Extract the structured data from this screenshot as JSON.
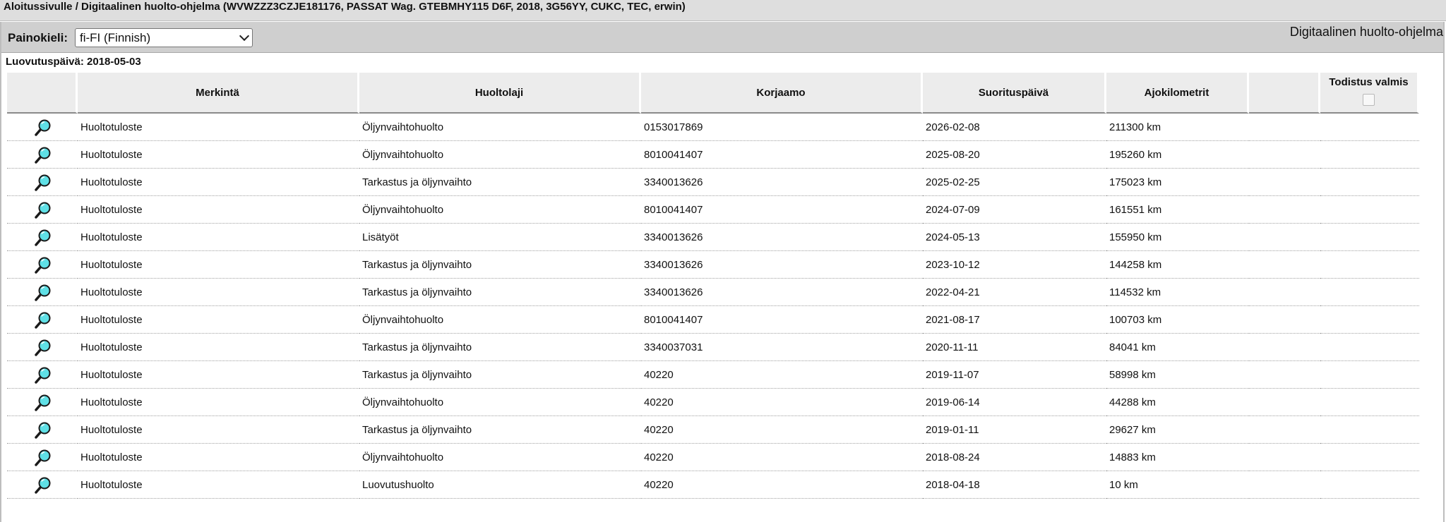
{
  "breadcrumb": "Aloitussivulle / Digitaalinen huolto-ohjelma (WVWZZZ3CZJE181176, PASSAT Wag. GTEBMHY115 D6F, 2018, 3G56YY, CUKC, TEC, erwin)",
  "toolbar": {
    "language_label": "Painokieli:",
    "language_value": "fi-FI (Finnish)",
    "title": "Digitaalinen huolto-ohjelma"
  },
  "handover_date": "Luovutuspäivä: 2018-05-03",
  "table": {
    "headers": {
      "marking": "Merkintä",
      "service_type": "Huoltolaji",
      "workshop": "Korjaamo",
      "date": "Suorituspäivä",
      "mileage": "Ajokilometrit",
      "certificate": "Todistus valmis"
    },
    "rows": [
      {
        "marking": "Huoltotuloste",
        "service_type": "Öljynvaihtohuolto",
        "workshop": "0153017869",
        "date": "2026-02-08",
        "mileage": "211300 km"
      },
      {
        "marking": "Huoltotuloste",
        "service_type": "Öljynvaihtohuolto",
        "workshop": "8010041407",
        "date": "2025-08-20",
        "mileage": "195260 km"
      },
      {
        "marking": "Huoltotuloste",
        "service_type": "Tarkastus ja öljynvaihto",
        "workshop": "3340013626",
        "date": "2025-02-25",
        "mileage": "175023 km"
      },
      {
        "marking": "Huoltotuloste",
        "service_type": "Öljynvaihtohuolto",
        "workshop": "8010041407",
        "date": "2024-07-09",
        "mileage": "161551 km"
      },
      {
        "marking": "Huoltotuloste",
        "service_type": "Lisätyöt",
        "workshop": "3340013626",
        "date": "2024-05-13",
        "mileage": "155950 km"
      },
      {
        "marking": "Huoltotuloste",
        "service_type": "Tarkastus ja öljynvaihto",
        "workshop": "3340013626",
        "date": "2023-10-12",
        "mileage": "144258 km"
      },
      {
        "marking": "Huoltotuloste",
        "service_type": "Tarkastus ja öljynvaihto",
        "workshop": "3340013626",
        "date": "2022-04-21",
        "mileage": "114532 km"
      },
      {
        "marking": "Huoltotuloste",
        "service_type": "Öljynvaihtohuolto",
        "workshop": "8010041407",
        "date": "2021-08-17",
        "mileage": "100703 km"
      },
      {
        "marking": "Huoltotuloste",
        "service_type": "Tarkastus ja öljynvaihto",
        "workshop": "3340037031",
        "date": "2020-11-11",
        "mileage": "84041 km"
      },
      {
        "marking": "Huoltotuloste",
        "service_type": "Tarkastus ja öljynvaihto",
        "workshop": "40220",
        "date": "2019-11-07",
        "mileage": "58998 km"
      },
      {
        "marking": "Huoltotuloste",
        "service_type": "Öljynvaihtohuolto",
        "workshop": "40220",
        "date": "2019-06-14",
        "mileage": "44288 km"
      },
      {
        "marking": "Huoltotuloste",
        "service_type": "Tarkastus ja öljynvaihto",
        "workshop": "40220",
        "date": "2019-01-11",
        "mileage": "29627 km"
      },
      {
        "marking": "Huoltotuloste",
        "service_type": "Öljynvaihtohuolto",
        "workshop": "40220",
        "date": "2018-08-24",
        "mileage": "14883 km"
      },
      {
        "marking": "Huoltotuloste",
        "service_type": "Luovutushuolto",
        "workshop": "40220",
        "date": "2018-04-18",
        "mileage": "10 km"
      }
    ]
  },
  "icons": {
    "row_view": "magnifier-icon",
    "select_chevron": "chevron-down-icon"
  }
}
